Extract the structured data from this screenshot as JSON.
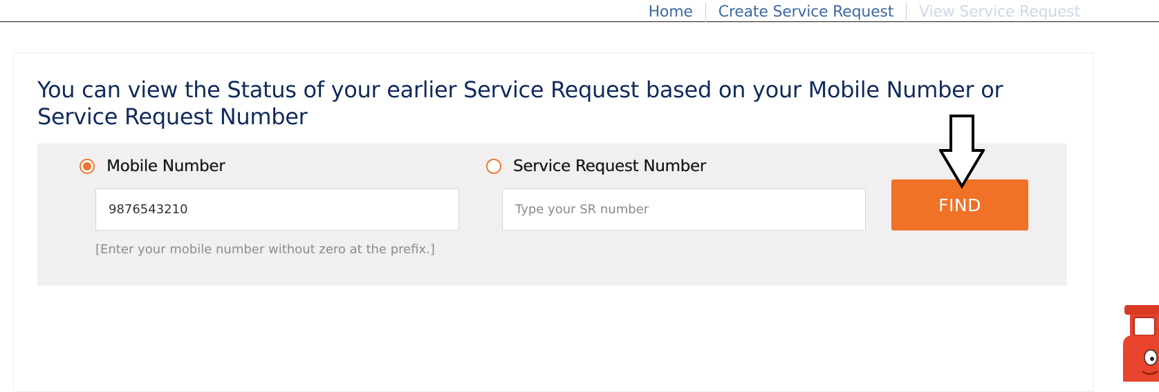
{
  "nav": {
    "links": [
      {
        "label": "Home"
      },
      {
        "label": "Create Service Request"
      },
      {
        "label": "View Service Request"
      }
    ]
  },
  "main": {
    "heading": "You can view the Status of your earlier Service Request based on your Mobile Number or Service Request Number",
    "options": {
      "mobile": {
        "label": "Mobile Number",
        "selected": true
      },
      "sr": {
        "label": "Service Request Number",
        "selected": false
      }
    },
    "mobile_input": {
      "value": "9876543210",
      "placeholder": ""
    },
    "sr_input": {
      "value": "",
      "placeholder": "Type your SR number"
    },
    "hint": "[Enter your mobile number without zero at the prefix.]",
    "find_label": "FIND"
  },
  "colors": {
    "accent": "#f07227",
    "heading": "#102a5c",
    "link": "#3d6aa1",
    "panel": "#f1efef"
  },
  "icons": {
    "annotation": "down-arrow-icon",
    "mascot": "gas-cylinder-mascot-icon"
  }
}
